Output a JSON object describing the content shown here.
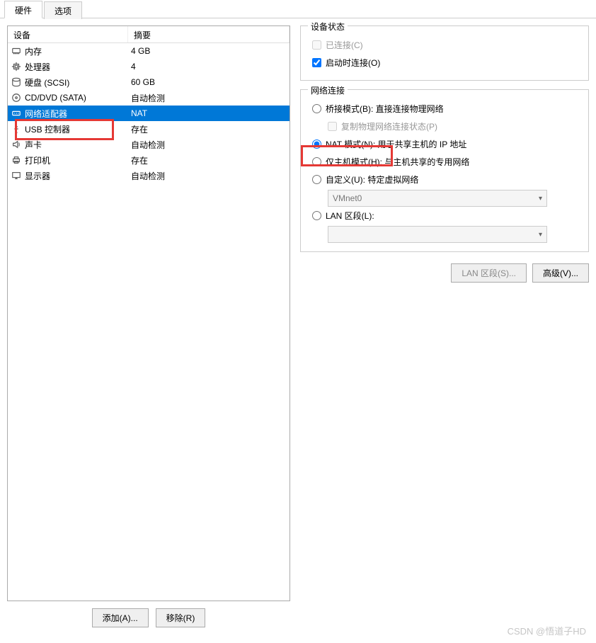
{
  "tabs": {
    "hardware": "硬件",
    "options": "选项"
  },
  "headers": {
    "device": "设备",
    "summary": "摘要"
  },
  "devices": [
    {
      "icon": "memory-icon",
      "name": "内存",
      "summary": "4 GB"
    },
    {
      "icon": "cpu-icon",
      "name": "处理器",
      "summary": "4"
    },
    {
      "icon": "disk-icon",
      "name": "硬盘 (SCSI)",
      "summary": "60 GB"
    },
    {
      "icon": "cd-icon",
      "name": "CD/DVD (SATA)",
      "summary": "自动检测"
    },
    {
      "icon": "network-icon",
      "name": "网络适配器",
      "summary": "NAT"
    },
    {
      "icon": "usb-icon",
      "name": "USB 控制器",
      "summary": "存在"
    },
    {
      "icon": "sound-icon",
      "name": "声卡",
      "summary": "自动检测"
    },
    {
      "icon": "printer-icon",
      "name": "打印机",
      "summary": "存在"
    },
    {
      "icon": "display-icon",
      "name": "显示器",
      "summary": "自动检测"
    }
  ],
  "selected_index": 4,
  "buttons": {
    "add": "添加(A)...",
    "remove": "移除(R)"
  },
  "device_status": {
    "title": "设备状态",
    "connected": "已连接(C)",
    "connect_at_power": "启动时连接(O)"
  },
  "network": {
    "title": "网络连接",
    "bridged": "桥接模式(B): 直接连接物理网络",
    "replicate": "复制物理网络连接状态(P)",
    "nat": "NAT 模式(N): 用于共享主机的 IP 地址",
    "hostonly": "仅主机模式(H): 与主机共享的专用网络",
    "custom": "自定义(U): 特定虚拟网络",
    "custom_value": "VMnet0",
    "lan": "LAN 区段(L):",
    "lan_value": ""
  },
  "right_buttons": {
    "lan_segments": "LAN 区段(S)...",
    "advanced": "高级(V)..."
  },
  "watermark": "CSDN @悟道子HD"
}
